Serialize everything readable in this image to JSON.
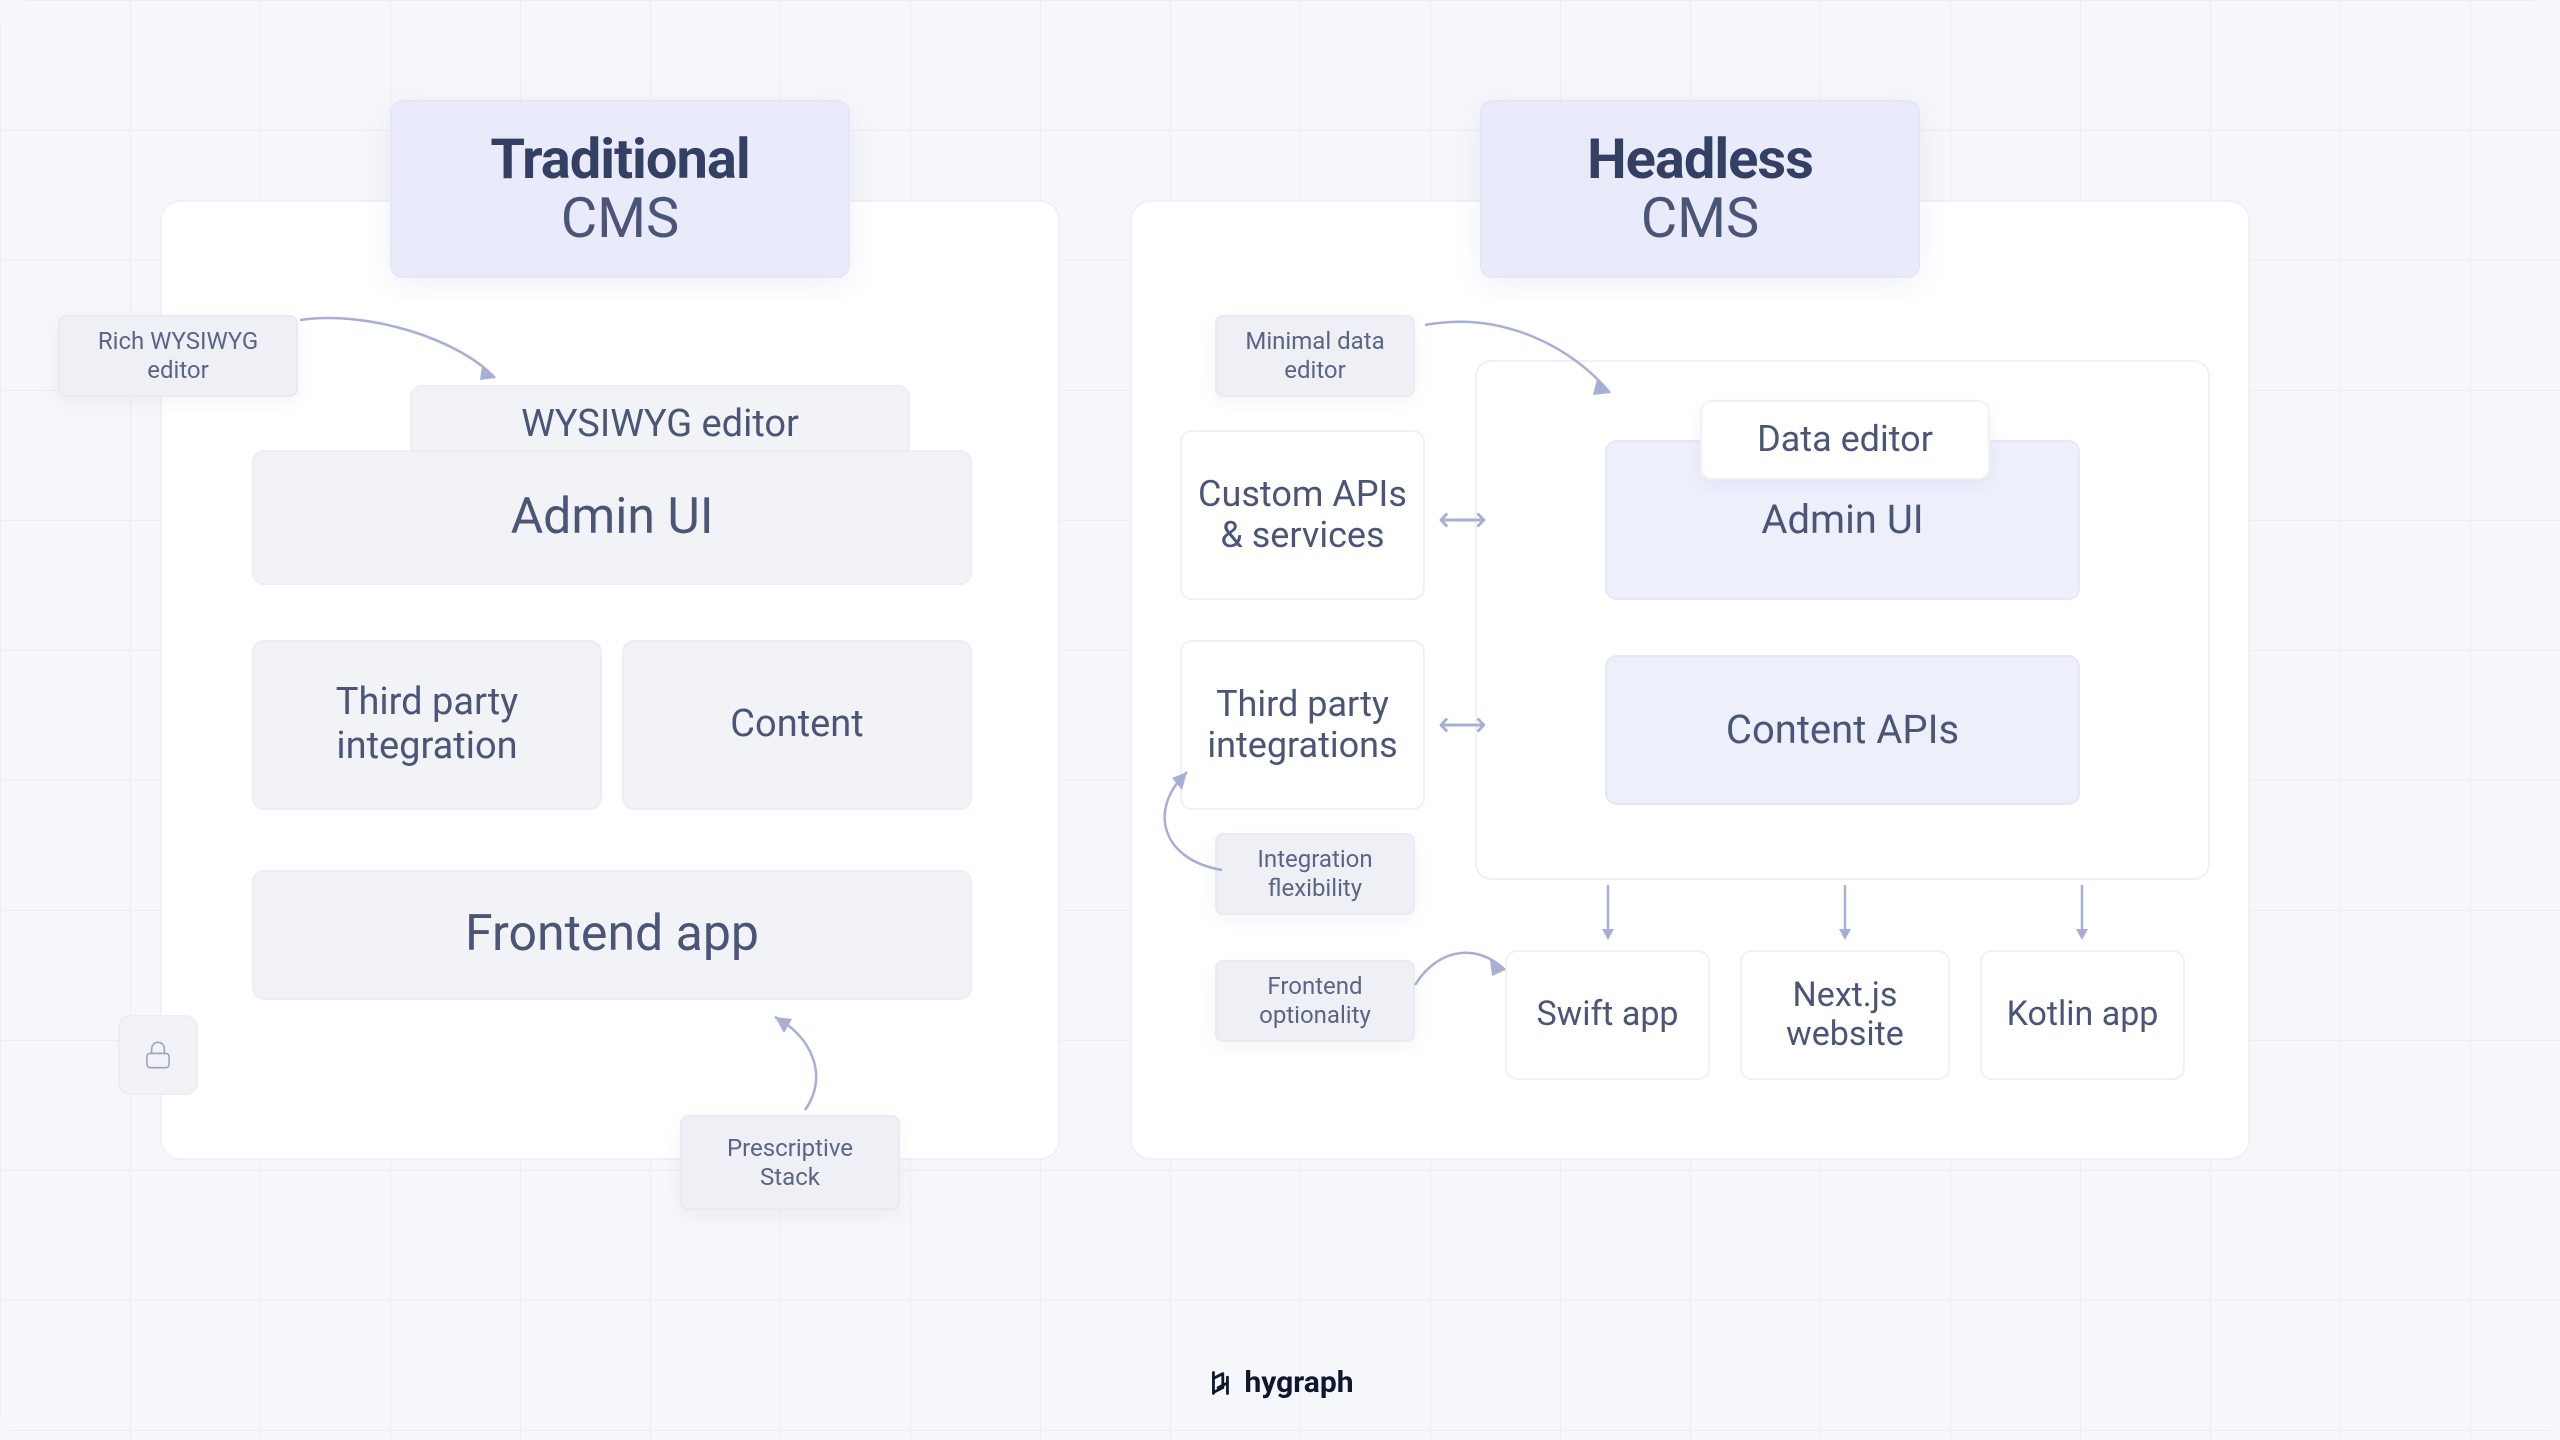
{
  "traditional": {
    "title_bold": "Traditional",
    "title_light": "CMS",
    "wysiwyg": "WYSIWYG editor",
    "admin": "Admin UI",
    "third_party": "Third party integration",
    "content": "Content",
    "frontend": "Frontend app",
    "tag_editor": "Rich WYSIWYG editor",
    "tag_stack": "Prescriptive Stack"
  },
  "headless": {
    "title_bold": "Headless",
    "title_light": "CMS",
    "custom_apis": "Custom APIs & services",
    "third_party": "Third party integrations",
    "data_editor": "Data editor",
    "admin": "Admin UI",
    "content_apis": "Content APIs",
    "swift": "Swift app",
    "nextjs": "Next.js website",
    "kotlin": "Kotlin app",
    "tag_editor": "Minimal data editor",
    "tag_flex": "Integration flexibility",
    "tag_frontend": "Frontend optionality"
  },
  "brand": "hygraph"
}
